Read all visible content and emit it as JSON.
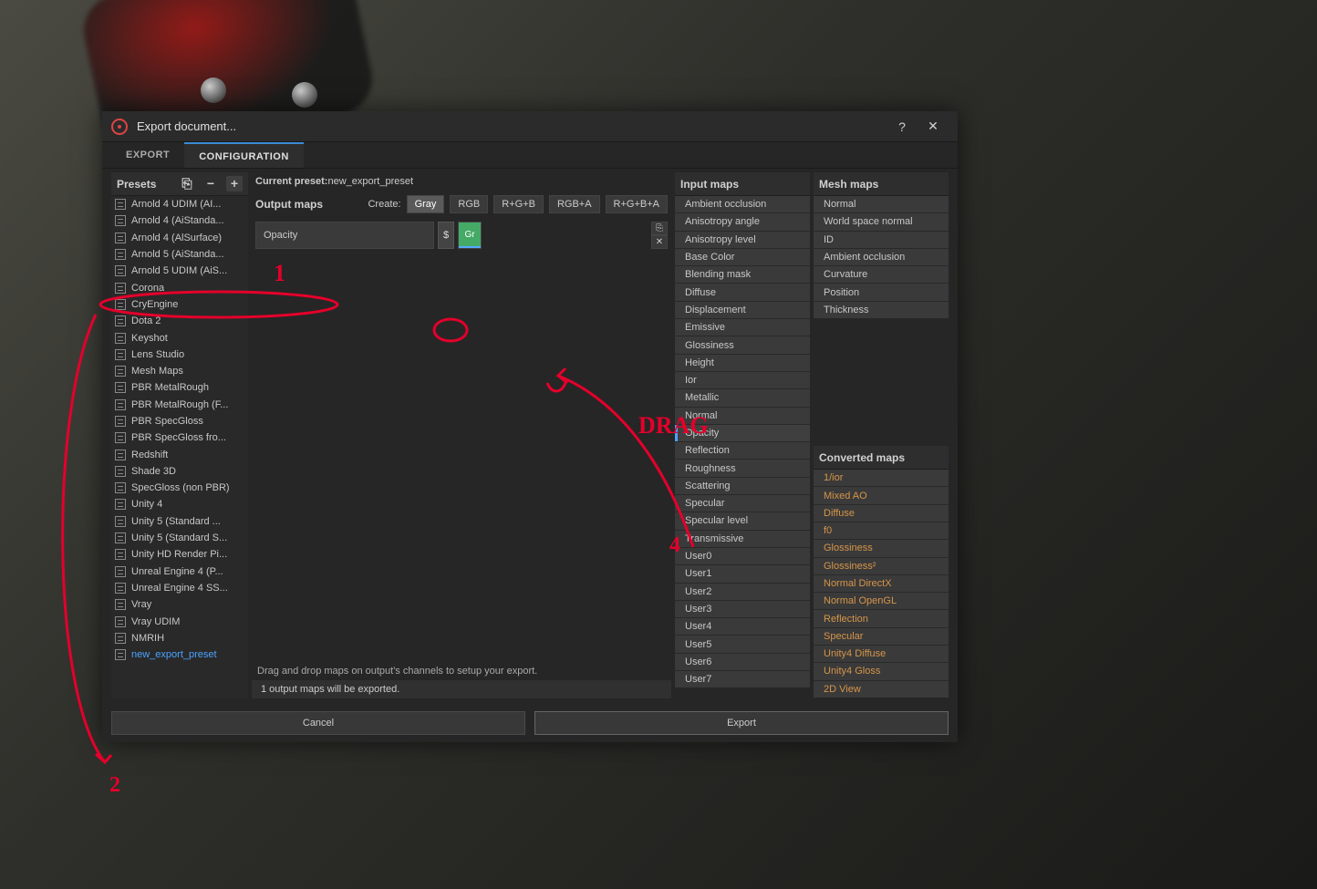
{
  "window": {
    "title": "Export document...",
    "help": "?",
    "close": "✕"
  },
  "tabs": [
    {
      "id": "export",
      "label": "EXPORT",
      "active": false
    },
    {
      "id": "config",
      "label": "CONFIGURATION",
      "active": true
    }
  ],
  "preset_panel": {
    "title": "Presets",
    "copy": "⎘",
    "minus": "−",
    "plus": "+",
    "items": [
      "Arnold 4  UDIM (AI...",
      "Arnold 4 (AiStanda...",
      "Arnold 4 (AlSurface)",
      "Arnold 5 (AiStanda...",
      "Arnold 5 UDIM (AiS...",
      "Corona",
      "CryEngine",
      "Dota 2",
      "Keyshot",
      "Lens Studio",
      "Mesh Maps",
      "PBR MetalRough",
      "PBR MetalRough (F...",
      "PBR SpecGloss",
      "PBR SpecGloss fro...",
      "Redshift",
      "Shade 3D",
      "SpecGloss (non PBR)",
      "Unity 4",
      "Unity 5 (Standard ...",
      "Unity 5 (Standard S...",
      "Unity HD Render Pi...",
      "Unreal Engine 4 (P...",
      "Unreal Engine 4 SS...",
      "Vray",
      "Vray UDIM",
      "NMRIH",
      "new_export_preset"
    ],
    "selected_index": 27
  },
  "center": {
    "current_preset_label": "Current preset:",
    "current_preset_value": "new_export_preset",
    "output_maps_label": "Output maps",
    "create_label": "Create:",
    "create_options": [
      "Gray",
      "RGB",
      "R+G+B",
      "RGB+A",
      "R+G+B+A"
    ],
    "create_selected_index": 0,
    "output_row": {
      "name": "Opacity",
      "dollar": "$",
      "slot_label": "Gr",
      "row_copy": "⎘",
      "row_close": "✕"
    },
    "hint": "Drag and drop maps on output's channels to setup your export.",
    "status": "1 output maps will be exported."
  },
  "input_maps": {
    "title": "Input maps",
    "items": [
      "Ambient occlusion",
      "Anisotropy angle",
      "Anisotropy level",
      "Base Color",
      "Blending mask",
      "Diffuse",
      "Displacement",
      "Emissive",
      "Glossiness",
      "Height",
      "Ior",
      "Metallic",
      "Normal",
      "Opacity",
      "Reflection",
      "Roughness",
      "Scattering",
      "Specular",
      "Specular level",
      "Transmissive",
      "User0",
      "User1",
      "User2",
      "User3",
      "User4",
      "User5",
      "User6",
      "User7"
    ],
    "selected_index": 13
  },
  "mesh_maps": {
    "title": "Mesh maps",
    "items": [
      "Normal",
      "World space normal",
      "ID",
      "Ambient occlusion",
      "Curvature",
      "Position",
      "Thickness"
    ]
  },
  "converted_maps": {
    "title": "Converted maps",
    "items": [
      "1/ior",
      "Mixed AO",
      "Diffuse",
      "f0",
      "Glossiness",
      "Glossiness²",
      "Normal DirectX",
      "Normal OpenGL",
      "Reflection",
      "Specular",
      "Unity4 Diffuse",
      "Unity4 Gloss",
      "2D View"
    ]
  },
  "footer": {
    "cancel": "Cancel",
    "export": "Export"
  },
  "annotations": {
    "one": "1",
    "two": "2",
    "three": "3",
    "four": "4",
    "drag": "DRAG"
  }
}
